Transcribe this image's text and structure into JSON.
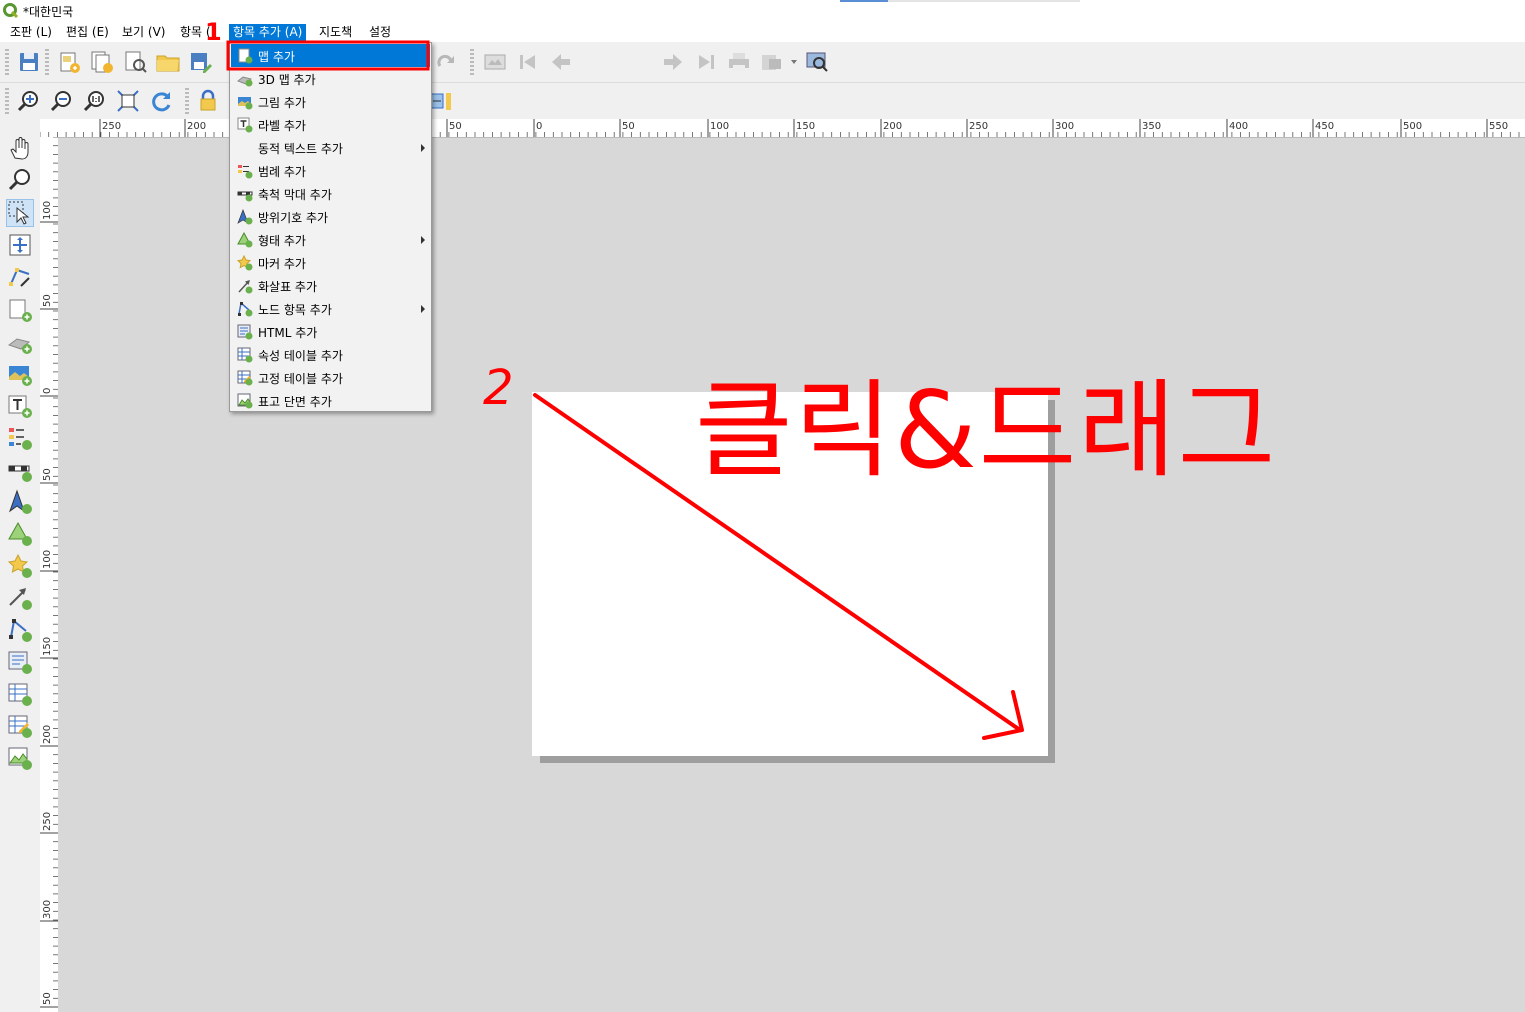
{
  "window": {
    "title": "*대한민국"
  },
  "menubar": {
    "items": [
      {
        "label": "조판 (L)"
      },
      {
        "label": "편집 (E)"
      },
      {
        "label": "보기 (V)"
      },
      {
        "label": "항목 ("
      },
      {
        "label": "항목 추가 (A)",
        "active": true
      },
      {
        "label": "지도책"
      },
      {
        "label": "설정"
      }
    ]
  },
  "navigation": {
    "page_value": "1"
  },
  "add_item_menu": {
    "items": [
      {
        "label": "맵 추가",
        "icon": "add-map-icon",
        "highlighted": true
      },
      {
        "label": "3D 맵 추가",
        "icon": "add-3d-map-icon"
      },
      {
        "label": "그림 추가",
        "icon": "add-picture-icon"
      },
      {
        "label": "라벨 추가",
        "icon": "add-label-icon"
      },
      {
        "label": "동적 텍스트 추가",
        "icon": "",
        "submenu": true
      },
      {
        "label": "범례 추가",
        "icon": "add-legend-icon"
      },
      {
        "label": "축척 막대 추가",
        "icon": "add-scalebar-icon"
      },
      {
        "label": "방위기호 추가",
        "icon": "add-north-arrow-icon"
      },
      {
        "label": "형태 추가",
        "icon": "add-shape-icon",
        "submenu": true
      },
      {
        "label": "마커 추가",
        "icon": "add-marker-icon"
      },
      {
        "label": "화살표 추가",
        "icon": "add-arrow-icon"
      },
      {
        "label": "노드 항목 추가",
        "icon": "add-node-item-icon",
        "submenu": true
      },
      {
        "label": "HTML 추가",
        "icon": "add-html-icon"
      },
      {
        "label": "속성 테이블 추가",
        "icon": "add-attribute-table-icon"
      },
      {
        "label": "고정 테이블 추가",
        "icon": "add-fixed-table-icon"
      },
      {
        "label": "표고 단면 추가",
        "icon": "add-elevation-profile-icon"
      }
    ]
  },
  "rulers": {
    "horizontal_labels": [
      "250",
      "200",
      "50",
      "0",
      "50",
      "100",
      "150",
      "200",
      "250",
      "300",
      "350",
      "400",
      "450",
      "500",
      "550"
    ],
    "vertical_labels": [
      "100",
      "50",
      "0",
      "50",
      "100",
      "150",
      "200",
      "250",
      "300",
      "50"
    ]
  },
  "annotations": {
    "step1": "1",
    "step2": "2",
    "instruction": "클릭&드래그"
  },
  "colors": {
    "accent": "#0078d7",
    "annotation": "#ff0000",
    "canvas": "#d8d8d8",
    "menu_bg": "#f2f2f2"
  }
}
